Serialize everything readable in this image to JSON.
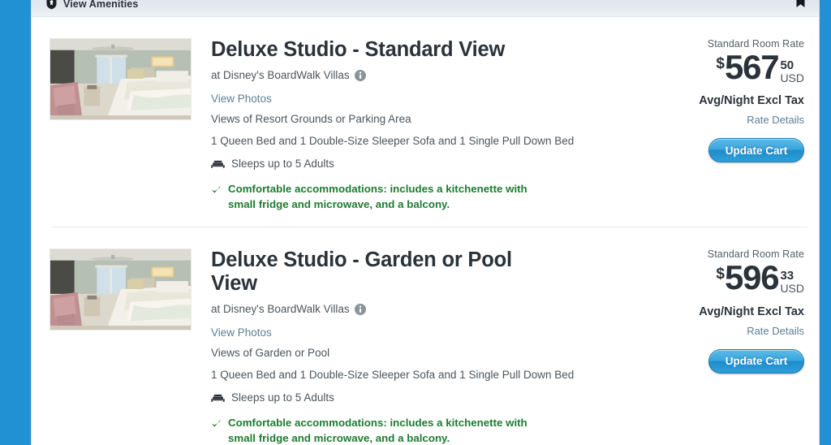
{
  "amenity_bar": {
    "label": "View Amenities",
    "shield_icon": "shield-badge-icon",
    "bookmark_icon": "bookmark-icon",
    "background_color": "#e3eaef"
  },
  "colors": {
    "side_band_blue": "#2191d3",
    "link_blue": "#5d7f94",
    "highlight_green": "#1f7a32",
    "heading_dark": "#2b333a",
    "button_blue": "#2ea0d8"
  },
  "rooms": [
    {
      "title": "Deluxe Studio - Standard View",
      "resort": "at Disney's BoardWalk Villas",
      "info_icon": "info-icon",
      "view_photos": "View Photos",
      "view_description": "Views of Resort Grounds or Parking Area",
      "bed_description": "1 Queen Bed and 1 Double-Size Sleeper Sofa and 1 Single Pull Down Bed",
      "sleeps": "Sleeps up to 5 Adults",
      "bed_icon": "bed-icon",
      "check_icon": "check-icon",
      "highlight": "Comfortable accommodations: includes a kitchenette with small fridge and microwave, and a balcony.",
      "price": {
        "rate_label": "Standard Room Rate",
        "currency_sign": "$",
        "amount": "567",
        "cents": "50",
        "currency_code": "USD",
        "qualifier": "Avg/Night Excl Tax",
        "rate_details": "Rate Details"
      },
      "cart_button": "Update Cart"
    },
    {
      "title": "Deluxe Studio - Garden or Pool View",
      "resort": "at Disney's BoardWalk Villas",
      "info_icon": "info-icon",
      "view_photos": "View Photos",
      "view_description": "Views of Garden or Pool",
      "bed_description": "1 Queen Bed and 1 Double-Size Sleeper Sofa and 1 Single Pull Down Bed",
      "sleeps": "Sleeps up to 5 Adults",
      "bed_icon": "bed-icon",
      "check_icon": "check-icon",
      "highlight": "Comfortable accommodations: includes a kitchenette with small fridge and microwave, and a balcony.",
      "price": {
        "rate_label": "Standard Room Rate",
        "currency_sign": "$",
        "amount": "596",
        "cents": "33",
        "currency_code": "USD",
        "qualifier": "Avg/Night Excl Tax",
        "rate_details": "Rate Details"
      },
      "cart_button": "Update Cart"
    }
  ]
}
